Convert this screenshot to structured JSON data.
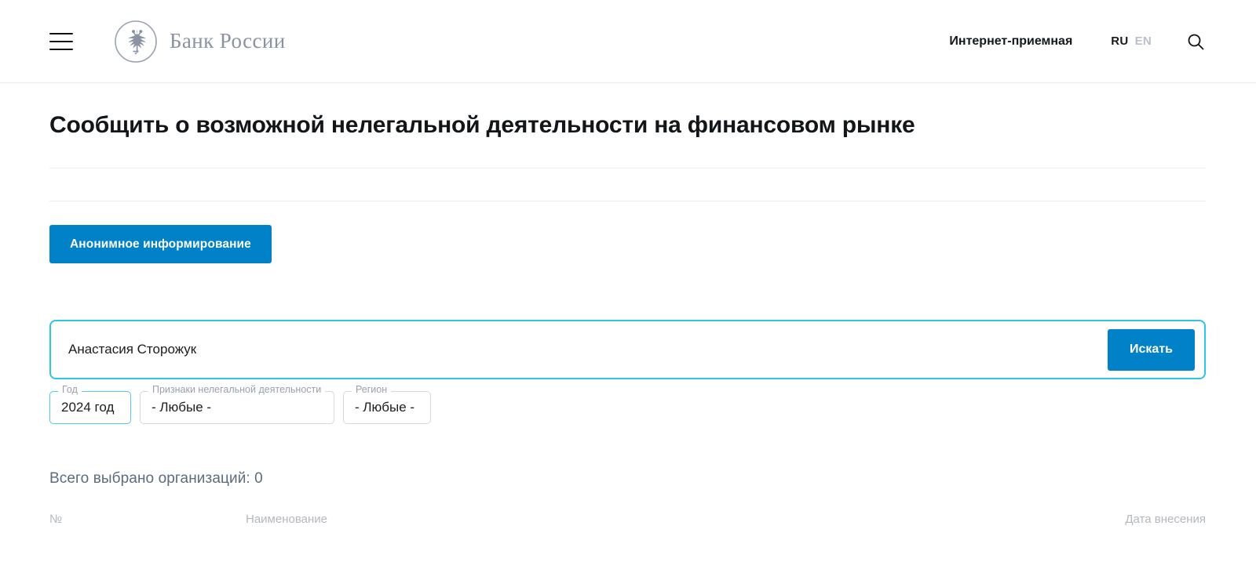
{
  "header": {
    "menu_icon": "hamburger-menu-icon",
    "brand_name": "Банк России",
    "brand_emblem_icon": "double-headed-eagle-emblem",
    "reception_link": "Интернет-приемная",
    "lang_active": "RU",
    "lang_inactive": "EN",
    "search_icon": "search-icon"
  },
  "main": {
    "page_title": "Сообщить о возможной нелегальной деятельности на финансовом рынке",
    "anon_button": "Анонимное информирование"
  },
  "search": {
    "value": "Анастасия Сторожук",
    "placeholder": "",
    "submit_label": "Искать"
  },
  "filters": [
    {
      "label": "Год",
      "value": "2024 год"
    },
    {
      "label": "Признаки нелегальной деятельности",
      "value": "- Любые -"
    },
    {
      "label": "Регион",
      "value": "- Любые -"
    }
  ],
  "results": {
    "count_text": "Всего выбрано организаций: 0",
    "columns": {
      "number": "№",
      "name": "Наименование",
      "date": "Дата внесения"
    }
  },
  "colors": {
    "accent_blue": "#0081c8",
    "focus_cyan": "#2ec4e8",
    "brand_gray": "#8a92a3",
    "muted_text": "#5c6b7e"
  }
}
